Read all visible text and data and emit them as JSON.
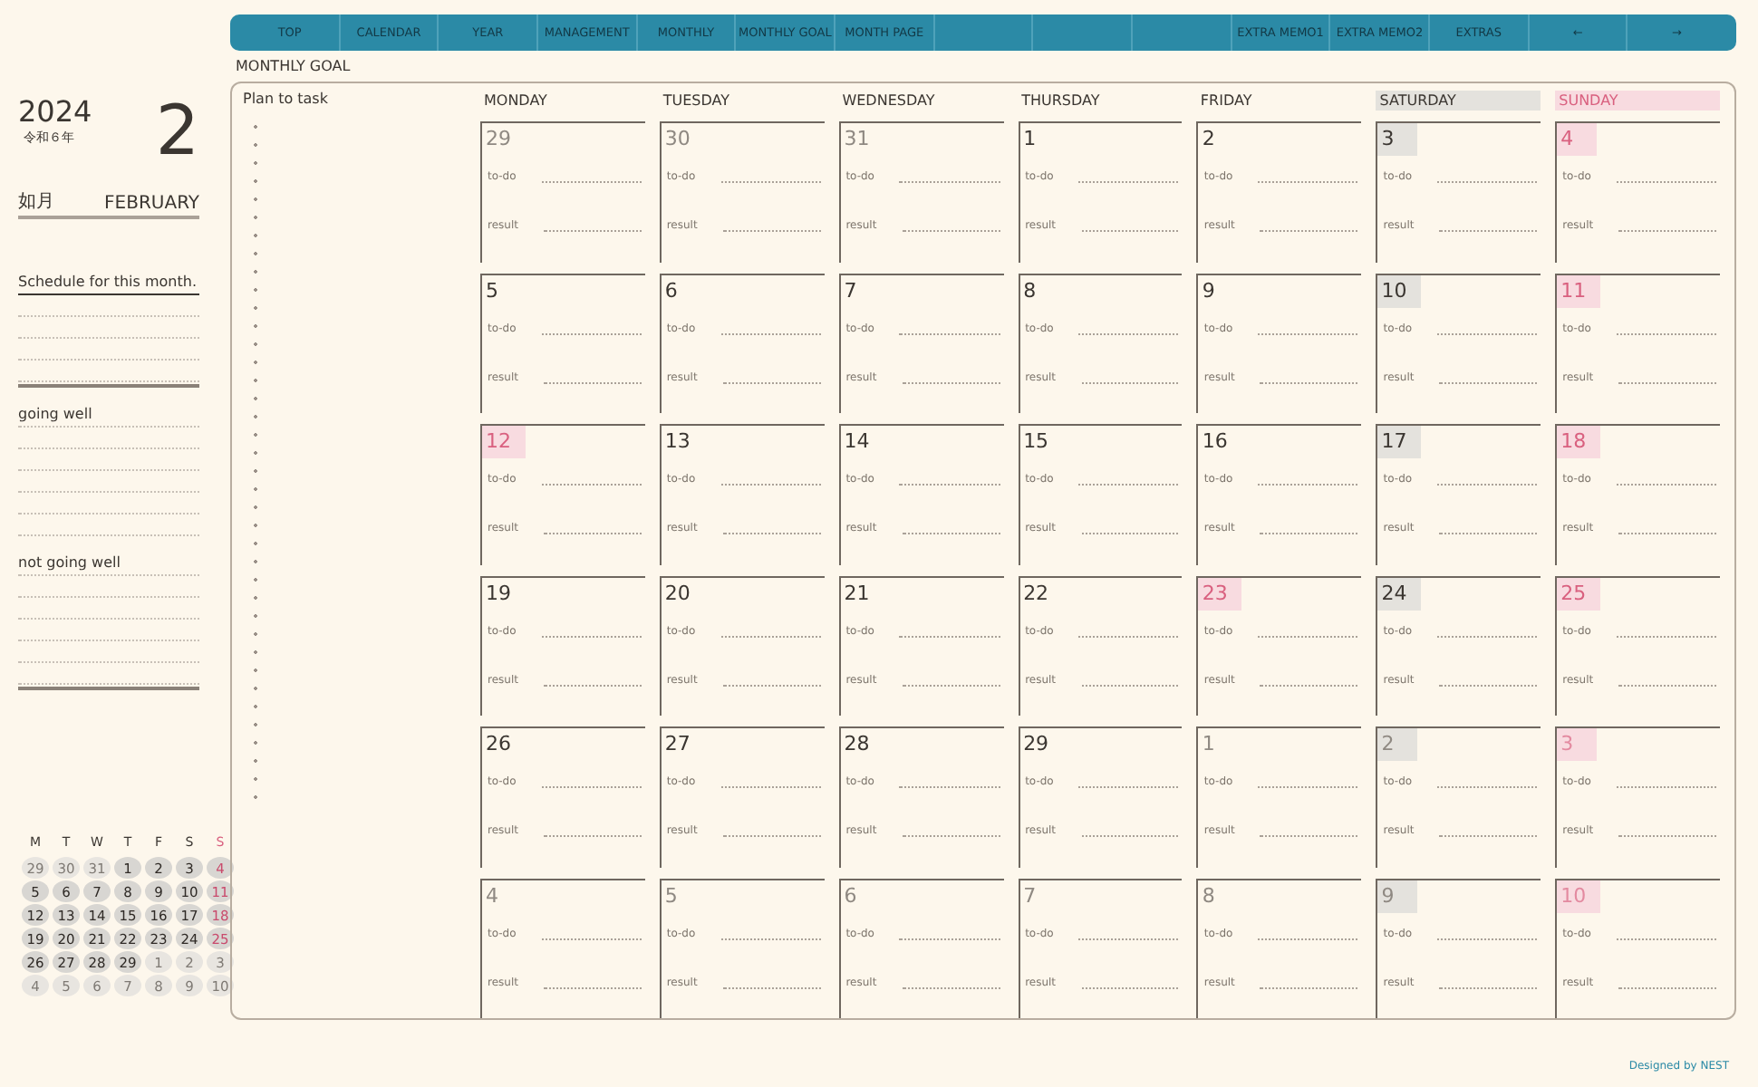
{
  "nav": [
    {
      "kind": "link",
      "label": "TOP"
    },
    {
      "kind": "link",
      "label": "CALENDAR"
    },
    {
      "kind": "link",
      "label": "YEAR"
    },
    {
      "kind": "link",
      "label": "MANAGEMENT"
    },
    {
      "kind": "link",
      "label": "MONTHLY"
    },
    {
      "kind": "link",
      "label": "MONTHLY GOAL"
    },
    {
      "kind": "link",
      "label": "MONTH PAGE"
    },
    {
      "kind": "blank"
    },
    {
      "kind": "blank"
    },
    {
      "kind": "blank"
    },
    {
      "kind": "link",
      "label": "EXTRA MEMO1"
    },
    {
      "kind": "link",
      "label": "EXTRA MEMO2"
    },
    {
      "kind": "link",
      "label": "EXTRAS"
    },
    {
      "kind": "link",
      "label": "←"
    },
    {
      "kind": "link",
      "label": "→"
    }
  ],
  "side": {
    "year": "2024",
    "era": "令和６年",
    "month_number": "2",
    "month_jp": "如月",
    "month_en": "FEBRUARY",
    "sections": [
      {
        "title": "Schedule for this month."
      },
      {
        "title": "going well"
      },
      {
        "title": "not going well"
      }
    ]
  },
  "mini_calendar": {
    "headers": [
      {
        "label": "M",
        "kind": "weekday"
      },
      {
        "label": "T",
        "kind": "weekday"
      },
      {
        "label": "W",
        "kind": "weekday"
      },
      {
        "label": "T",
        "kind": "weekday"
      },
      {
        "label": "F",
        "kind": "weekday"
      },
      {
        "label": "S",
        "kind": "weekday"
      },
      {
        "label": "S",
        "kind": "sunday"
      }
    ],
    "days": [
      {
        "n": "29",
        "other": true,
        "sunday": false
      },
      {
        "n": "30",
        "other": true,
        "sunday": false
      },
      {
        "n": "31",
        "other": true,
        "sunday": false
      },
      {
        "n": "1",
        "other": false,
        "sunday": false
      },
      {
        "n": "2",
        "other": false,
        "sunday": false
      },
      {
        "n": "3",
        "other": false,
        "sunday": false
      },
      {
        "n": "4",
        "other": false,
        "sunday": true
      },
      {
        "n": "5",
        "other": false,
        "sunday": false
      },
      {
        "n": "6",
        "other": false,
        "sunday": false
      },
      {
        "n": "7",
        "other": false,
        "sunday": false
      },
      {
        "n": "8",
        "other": false,
        "sunday": false
      },
      {
        "n": "9",
        "other": false,
        "sunday": false
      },
      {
        "n": "10",
        "other": false,
        "sunday": false
      },
      {
        "n": "11",
        "other": false,
        "sunday": true
      },
      {
        "n": "12",
        "other": false,
        "sunday": false
      },
      {
        "n": "13",
        "other": false,
        "sunday": false
      },
      {
        "n": "14",
        "other": false,
        "sunday": false
      },
      {
        "n": "15",
        "other": false,
        "sunday": false
      },
      {
        "n": "16",
        "other": false,
        "sunday": false
      },
      {
        "n": "17",
        "other": false,
        "sunday": false
      },
      {
        "n": "18",
        "other": false,
        "sunday": true
      },
      {
        "n": "19",
        "other": false,
        "sunday": false
      },
      {
        "n": "20",
        "other": false,
        "sunday": false
      },
      {
        "n": "21",
        "other": false,
        "sunday": false
      },
      {
        "n": "22",
        "other": false,
        "sunday": false
      },
      {
        "n": "23",
        "other": false,
        "sunday": false
      },
      {
        "n": "24",
        "other": false,
        "sunday": false
      },
      {
        "n": "25",
        "other": false,
        "sunday": true
      },
      {
        "n": "26",
        "other": false,
        "sunday": false
      },
      {
        "n": "27",
        "other": false,
        "sunday": false
      },
      {
        "n": "28",
        "other": false,
        "sunday": false
      },
      {
        "n": "29",
        "other": false,
        "sunday": false
      },
      {
        "n": "1",
        "other": true,
        "sunday": false
      },
      {
        "n": "2",
        "other": true,
        "sunday": false
      },
      {
        "n": "3",
        "other": true,
        "sunday": false
      },
      {
        "n": "4",
        "other": true,
        "sunday": false
      },
      {
        "n": "5",
        "other": true,
        "sunday": false
      },
      {
        "n": "6",
        "other": true,
        "sunday": false
      },
      {
        "n": "7",
        "other": true,
        "sunday": false
      },
      {
        "n": "8",
        "other": true,
        "sunday": false
      },
      {
        "n": "9",
        "other": true,
        "sunday": false
      },
      {
        "n": "10",
        "other": true,
        "sunday": false
      }
    ]
  },
  "goal_title": "MONTHLY GOAL",
  "plan_title": "Plan to task",
  "weekdays": [
    {
      "label": "MONDAY",
      "kind": "weekday"
    },
    {
      "label": "TUESDAY",
      "kind": "weekday"
    },
    {
      "label": "WEDNESDAY",
      "kind": "weekday"
    },
    {
      "label": "THURSDAY",
      "kind": "weekday"
    },
    {
      "label": "FRIDAY",
      "kind": "weekday"
    },
    {
      "label": "SATURDAY",
      "kind": "saturday"
    },
    {
      "label": "SUNDAY",
      "kind": "sunday"
    }
  ],
  "days": [
    {
      "n": "29",
      "other": true,
      "saturday": false,
      "holiday": false,
      "todo": "to-do",
      "result": "result"
    },
    {
      "n": "30",
      "other": true,
      "saturday": false,
      "holiday": false,
      "todo": "to-do",
      "result": "result"
    },
    {
      "n": "31",
      "other": true,
      "saturday": false,
      "holiday": false,
      "todo": "to-do",
      "result": "result"
    },
    {
      "n": "1",
      "other": false,
      "saturday": false,
      "holiday": false,
      "todo": "to-do",
      "result": "result"
    },
    {
      "n": "2",
      "other": false,
      "saturday": false,
      "holiday": false,
      "todo": "to-do",
      "result": "result"
    },
    {
      "n": "3",
      "other": false,
      "saturday": true,
      "holiday": false,
      "todo": "to-do",
      "result": "result"
    },
    {
      "n": "4",
      "other": false,
      "saturday": false,
      "holiday": true,
      "todo": "to-do",
      "result": "result"
    },
    {
      "n": "5",
      "other": false,
      "saturday": false,
      "holiday": false,
      "todo": "to-do",
      "result": "result"
    },
    {
      "n": "6",
      "other": false,
      "saturday": false,
      "holiday": false,
      "todo": "to-do",
      "result": "result"
    },
    {
      "n": "7",
      "other": false,
      "saturday": false,
      "holiday": false,
      "todo": "to-do",
      "result": "result"
    },
    {
      "n": "8",
      "other": false,
      "saturday": false,
      "holiday": false,
      "todo": "to-do",
      "result": "result"
    },
    {
      "n": "9",
      "other": false,
      "saturday": false,
      "holiday": false,
      "todo": "to-do",
      "result": "result"
    },
    {
      "n": "10",
      "other": false,
      "saturday": true,
      "holiday": false,
      "todo": "to-do",
      "result": "result"
    },
    {
      "n": "11",
      "other": false,
      "saturday": false,
      "holiday": true,
      "todo": "to-do",
      "result": "result"
    },
    {
      "n": "12",
      "other": false,
      "saturday": false,
      "holiday": true,
      "todo": "to-do",
      "result": "result"
    },
    {
      "n": "13",
      "other": false,
      "saturday": false,
      "holiday": false,
      "todo": "to-do",
      "result": "result"
    },
    {
      "n": "14",
      "other": false,
      "saturday": false,
      "holiday": false,
      "todo": "to-do",
      "result": "result"
    },
    {
      "n": "15",
      "other": false,
      "saturday": false,
      "holiday": false,
      "todo": "to-do",
      "result": "result"
    },
    {
      "n": "16",
      "other": false,
      "saturday": false,
      "holiday": false,
      "todo": "to-do",
      "result": "result"
    },
    {
      "n": "17",
      "other": false,
      "saturday": true,
      "holiday": false,
      "todo": "to-do",
      "result": "result"
    },
    {
      "n": "18",
      "other": false,
      "saturday": false,
      "holiday": true,
      "todo": "to-do",
      "result": "result"
    },
    {
      "n": "19",
      "other": false,
      "saturday": false,
      "holiday": false,
      "todo": "to-do",
      "result": "result"
    },
    {
      "n": "20",
      "other": false,
      "saturday": false,
      "holiday": false,
      "todo": "to-do",
      "result": "result"
    },
    {
      "n": "21",
      "other": false,
      "saturday": false,
      "holiday": false,
      "todo": "to-do",
      "result": "result"
    },
    {
      "n": "22",
      "other": false,
      "saturday": false,
      "holiday": false,
      "todo": "to-do",
      "result": "result"
    },
    {
      "n": "23",
      "other": false,
      "saturday": false,
      "holiday": true,
      "todo": "to-do",
      "result": "result"
    },
    {
      "n": "24",
      "other": false,
      "saturday": true,
      "holiday": false,
      "todo": "to-do",
      "result": "result"
    },
    {
      "n": "25",
      "other": false,
      "saturday": false,
      "holiday": true,
      "todo": "to-do",
      "result": "result"
    },
    {
      "n": "26",
      "other": false,
      "saturday": false,
      "holiday": false,
      "todo": "to-do",
      "result": "result"
    },
    {
      "n": "27",
      "other": false,
      "saturday": false,
      "holiday": false,
      "todo": "to-do",
      "result": "result"
    },
    {
      "n": "28",
      "other": false,
      "saturday": false,
      "holiday": false,
      "todo": "to-do",
      "result": "result"
    },
    {
      "n": "29",
      "other": false,
      "saturday": false,
      "holiday": false,
      "todo": "to-do",
      "result": "result"
    },
    {
      "n": "1",
      "other": true,
      "saturday": false,
      "holiday": false,
      "todo": "to-do",
      "result": "result"
    },
    {
      "n": "2",
      "other": true,
      "saturday": true,
      "holiday": false,
      "todo": "to-do",
      "result": "result"
    },
    {
      "n": "3",
      "other": true,
      "saturday": false,
      "holiday": true,
      "todo": "to-do",
      "result": "result"
    },
    {
      "n": "4",
      "other": true,
      "saturday": false,
      "holiday": false,
      "todo": "to-do",
      "result": "result"
    },
    {
      "n": "5",
      "other": true,
      "saturday": false,
      "holiday": false,
      "todo": "to-do",
      "result": "result"
    },
    {
      "n": "6",
      "other": true,
      "saturday": false,
      "holiday": false,
      "todo": "to-do",
      "result": "result"
    },
    {
      "n": "7",
      "other": true,
      "saturday": false,
      "holiday": false,
      "todo": "to-do",
      "result": "result"
    },
    {
      "n": "8",
      "other": true,
      "saturday": false,
      "holiday": false,
      "todo": "to-do",
      "result": "result"
    },
    {
      "n": "9",
      "other": true,
      "saturday": true,
      "holiday": false,
      "todo": "to-do",
      "result": "result"
    },
    {
      "n": "10",
      "other": true,
      "saturday": false,
      "holiday": true,
      "todo": "to-do",
      "result": "result"
    }
  ],
  "footer": "Designed by NEST"
}
